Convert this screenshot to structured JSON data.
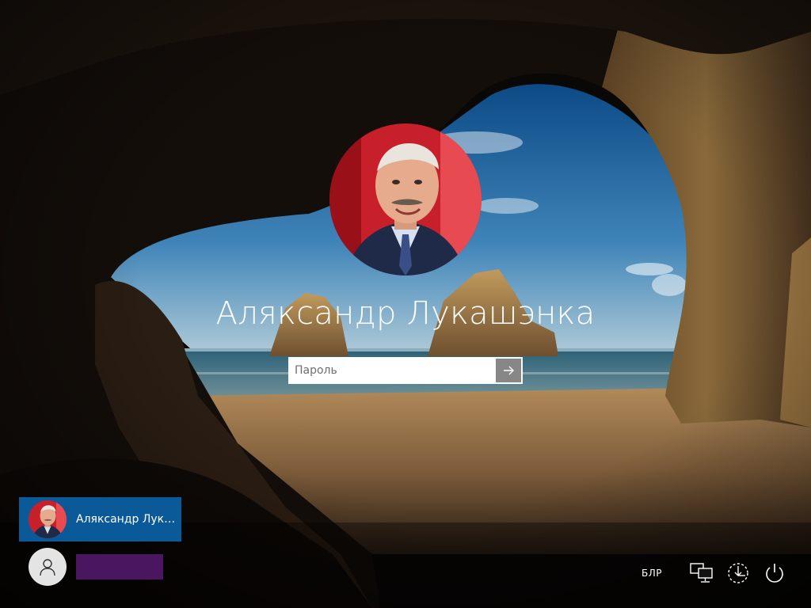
{
  "login": {
    "user_name": "Аляксандр Лукашэнка",
    "password_placeholder": "Пароль"
  },
  "user_list": [
    {
      "label": "Аляксандр Лука...",
      "selected": true
    },
    {
      "label": "",
      "selected": false
    }
  ],
  "tray": {
    "language": "БЛР",
    "icons": [
      "network-icon",
      "accessibility-icon",
      "power-icon"
    ]
  },
  "colors": {
    "selected_user_bg": "#0a5a9a",
    "other_user_bar": "#4a1660",
    "avatar_bg": "#e4e4e4"
  }
}
